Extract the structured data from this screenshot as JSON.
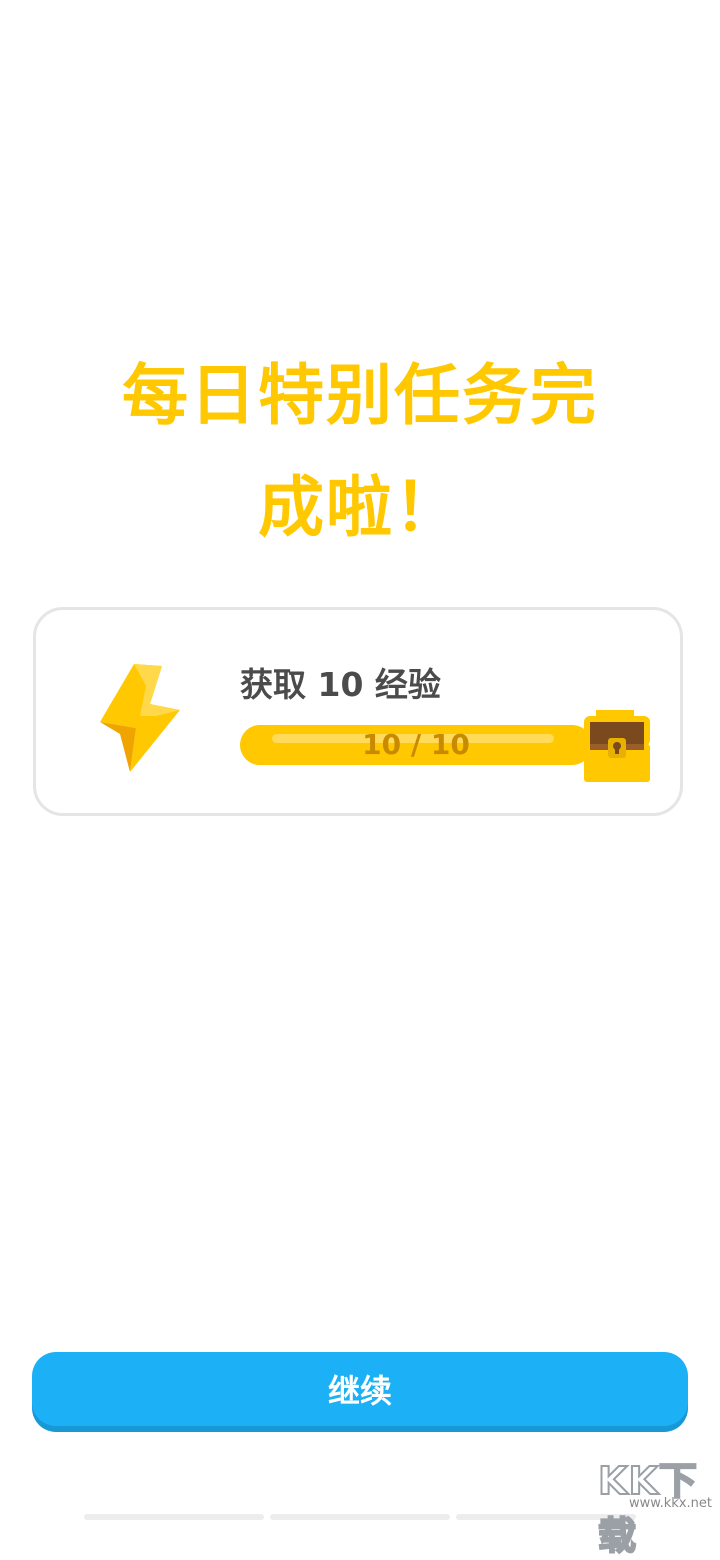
{
  "headline": {
    "line1": "每日特别任务完",
    "line2": "成啦！"
  },
  "quest": {
    "title": "获取 10 经验",
    "progress_text": "10 / 10",
    "progress_fraction": 1.0,
    "icon": "lightning-bolt-icon",
    "reward_icon": "treasure-chest-icon"
  },
  "continue_button": {
    "label": "继续"
  },
  "watermark": {
    "logo": "KK下载",
    "url": "www.kkx.net"
  },
  "colors": {
    "headline": "#FFC800",
    "progress": "#FFC800",
    "button": "#1CB0F6",
    "button_shadow": "#1899D6",
    "card_border": "#E5E5E5"
  }
}
